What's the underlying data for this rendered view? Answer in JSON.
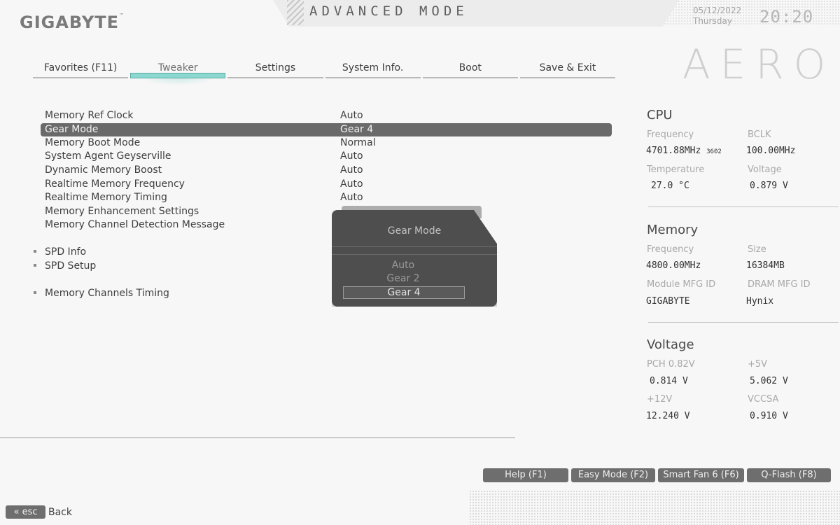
{
  "header": {
    "brand": "GIGABYTE",
    "brand_tm": "™",
    "mode_title": "ADVANCED MODE",
    "date": "05/12/2022",
    "weekday": "Thursday",
    "time": "20:20",
    "product_logo": "AERO"
  },
  "tabs": [
    {
      "label": "Favorites (F11)",
      "active": false
    },
    {
      "label": "Tweaker",
      "active": true
    },
    {
      "label": "Settings",
      "active": false
    },
    {
      "label": "System Info.",
      "active": false
    },
    {
      "label": "Boot",
      "active": false
    },
    {
      "label": "Save & Exit",
      "active": false
    }
  ],
  "settings": {
    "rows": [
      {
        "label": "Memory Ref Clock",
        "value": "Auto"
      },
      {
        "label": "Gear Mode",
        "value": "Gear 4",
        "selected": true
      },
      {
        "label": "Memory Boot Mode",
        "value": "Normal"
      },
      {
        "label": "System Agent Geyserville",
        "value": "Auto"
      },
      {
        "label": "Dynamic Memory Boost",
        "value": "Auto"
      },
      {
        "label": "Realtime Memory Frequency",
        "value": "Auto"
      },
      {
        "label": "Realtime Memory Timing",
        "value": "Auto"
      },
      {
        "label": "Memory Enhancement Settings",
        "value": ""
      },
      {
        "label": "Memory Channel Detection Message",
        "value": ""
      }
    ],
    "submenus": [
      "SPD Info",
      "SPD Setup",
      "Memory Channels Timing"
    ]
  },
  "popup": {
    "title": "Gear Mode",
    "options": [
      "Auto",
      "Gear 2",
      "Gear 4"
    ],
    "selected_index": 2
  },
  "info": {
    "cpu": {
      "title": "CPU",
      "frequency_label": "Frequency",
      "frequency_value": "4701.88MHz",
      "frequency_extra": "3602",
      "bclk_label": "BCLK",
      "bclk_value": "100.00MHz",
      "temperature_label": "Temperature",
      "temperature_value": "27.0 °C",
      "voltage_label": "Voltage",
      "voltage_value": "0.879 V"
    },
    "memory": {
      "title": "Memory",
      "frequency_label": "Frequency",
      "frequency_value": "4800.00MHz",
      "size_label": "Size",
      "size_value": "16384MB",
      "module_mfg_label": "Module MFG ID",
      "module_mfg_value": "GIGABYTE",
      "dram_mfg_label": "DRAM MFG ID",
      "dram_mfg_value": "Hynix"
    },
    "voltage": {
      "title": "Voltage",
      "pch_label": "PCH 0.82V",
      "pch_value": "0.814 V",
      "v5_label": "+5V",
      "v5_value": "5.062 V",
      "v12_label": "+12V",
      "v12_value": "12.240 V",
      "vccsa_label": "VCCSA",
      "vccsa_value": "0.910 V"
    }
  },
  "footer": {
    "buttons": [
      "Help (F1)",
      "Easy Mode (F2)",
      "Smart Fan 6 (F6)",
      "Q-Flash (F8)"
    ],
    "esc_label": "« esc",
    "back_label": "Back"
  },
  "colors": {
    "accent_teal": "#8ad8d0",
    "selected_row": "#6a6a6a",
    "popup_bg": "#4e4e4e"
  }
}
